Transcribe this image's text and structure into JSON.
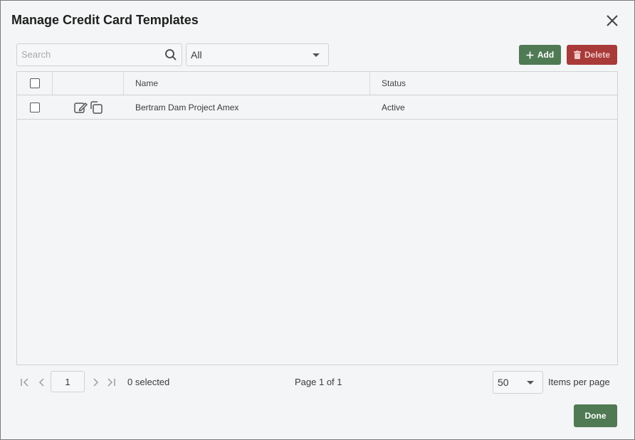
{
  "dialog": {
    "title": "Manage Credit Card Templates"
  },
  "toolbar": {
    "search_placeholder": "Search",
    "search_value": "",
    "filter_value": "All",
    "add_label": "Add",
    "delete_label": "Delete"
  },
  "grid": {
    "columns": [
      "",
      "",
      "Name",
      "Status"
    ],
    "rows": [
      {
        "name": "Bertram Dam Project Amex",
        "status": "Active",
        "checked": false
      }
    ]
  },
  "pager": {
    "current_page": "1",
    "selected_text": "0 selected",
    "page_info": "Page 1 of 1",
    "items_per_page": "50",
    "items_per_page_label": "Items per page"
  },
  "footer": {
    "done_label": "Done"
  },
  "colors": {
    "primary_green": "#4f7a54",
    "danger_red": "#a83a39",
    "background": "#f4f5f6",
    "border": "#cfd1d3"
  },
  "icons": [
    "close-icon",
    "search-icon",
    "plus-icon",
    "trash-icon",
    "edit-icon",
    "copy-icon",
    "first-page-icon",
    "prev-page-icon",
    "next-page-icon",
    "last-page-icon"
  ]
}
